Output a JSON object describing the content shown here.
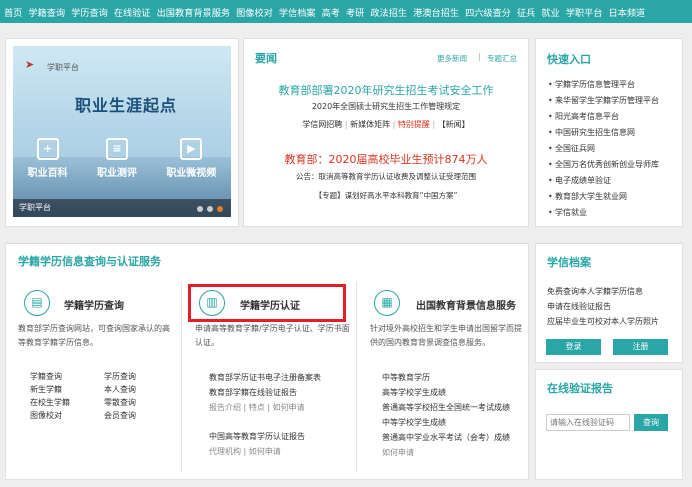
{
  "nav": [
    "首页",
    "学籍查询",
    "学历查询",
    "在线验证",
    "出国教育背景服务",
    "图像校对",
    "学信档案",
    "高考",
    "考研",
    "政法招生",
    "港澳台招生",
    "四六级查分",
    "征兵",
    "就业",
    "学职平台",
    "日本频道"
  ],
  "banner": {
    "logo": "学职平台",
    "headline": "职业生涯起点",
    "items": [
      "职业百科",
      "职业测评",
      "职业微视频"
    ],
    "footer": "学职平台"
  },
  "news": {
    "title": "要闻",
    "more": "更多新闻",
    "special": "专题汇总",
    "sep": "|",
    "headline1": "教育部部署2020年研究生招生考试安全工作",
    "line1": "2020年全国硕士研究生招生工作管理规定",
    "links": [
      "学信网招聘",
      "|",
      "新媒体矩阵",
      "|",
      "特别提醒",
      "|",
      "【新闻】"
    ],
    "headline2": "教育部：2020届高校毕业生预计874万人",
    "line2": "公告：取消高等教育学历认证收费及调整认证受理范围",
    "line3": "【专题】谋划好高水平本科教育“中国方案”"
  },
  "quick": {
    "title": "快速入口",
    "items": [
      "学籍学历信息管理平台",
      "来华留学生学籍学历管理平台",
      "阳光高考信息平台",
      "中国研究生招生信息网",
      "全国征兵网",
      "全国万名优秀创新创业导师库",
      "电子成绩单验证",
      "教育部大学生就业网",
      "学信就业"
    ]
  },
  "services": {
    "title": "学籍学历信息查询与认证服务",
    "query": {
      "title": "学籍学历查询",
      "desc": "教育部学历查询网站，可查询国家承认的高等教育学籍学历信息。",
      "links": [
        "学籍查询",
        "学历查询",
        "新生学籍",
        "本人查询",
        "在校生学籍",
        "零散查询",
        "图像校对",
        "会员查询"
      ]
    },
    "auth": {
      "title": "学籍学历认证",
      "desc": "申请高等教育学籍/学历电子认证、学历书面认证。",
      "l1": "教育部学历证书电子注册备案表",
      "l2": "教育部学籍在线验证报告",
      "l3": "报告介绍 | 特点 | 如何申请",
      "l4": "中国高等教育学历认证报告",
      "l5": "代理机构 | 如何申请"
    },
    "abroad": {
      "title": "出国教育背景信息服务",
      "desc": "针对境外高校招生和学生申请出国留学而提供的国内教育背景调查信息服务。",
      "lines": [
        "中等教育学历",
        "高等学校学生成绩",
        "普通高等学校招生全国统一考试成绩",
        "中等学校学生成绩",
        "普通高中学业水平考试（会考）成绩",
        "如何申请"
      ]
    }
  },
  "archive": {
    "title": "学信档案",
    "lines": [
      "免费查询本人学籍学历信息",
      "申请在线验证报告",
      "应届毕业生可校对本人学历照片"
    ],
    "login": "登录",
    "register": "注册"
  },
  "verify": {
    "title": "在线验证报告",
    "placeholder": "请输入在线验证码",
    "button": "查询"
  }
}
